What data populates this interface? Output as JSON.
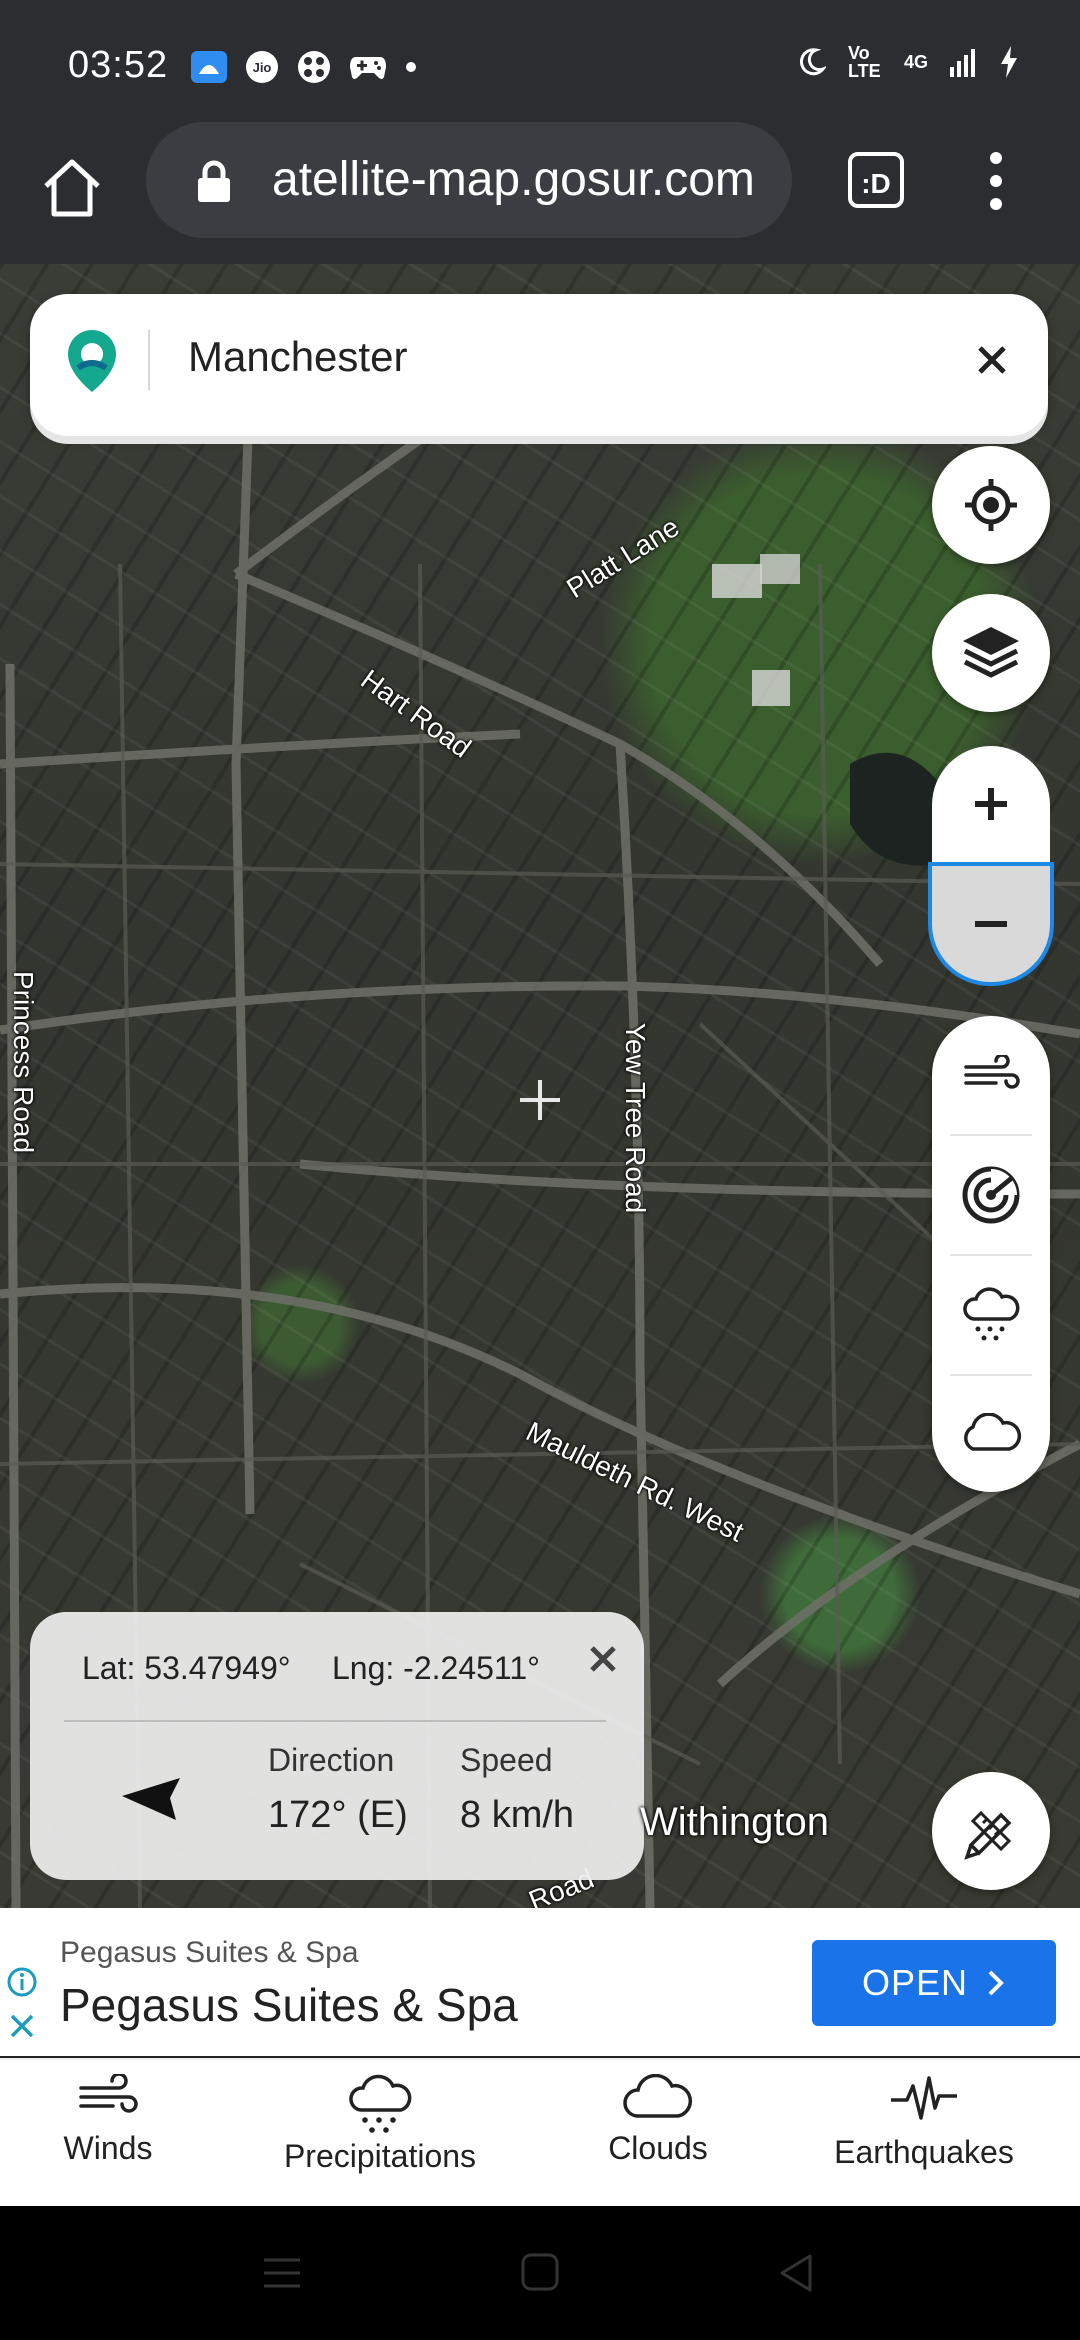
{
  "status_bar": {
    "time": "03:52",
    "network": "4G",
    "volte": "Vo LTE"
  },
  "browser": {
    "url": "atellite-map.gosur.com",
    "tabs_label": ":D"
  },
  "search": {
    "value": "Manchester"
  },
  "map": {
    "road_labels": {
      "platt_lane": "Platt Lane",
      "hart_road": "Hart Road",
      "yew_tree_road": "Yew Tree Road",
      "princess_road": "Princess Road",
      "mauldeth_rd_west": "Mauldeth Rd. West",
      "road_fragment": "Road"
    },
    "place_label": "Withington"
  },
  "info_card": {
    "lat": "Lat: 53.47949°",
    "lng": "Lng: -2.24511°",
    "direction_label": "Direction",
    "direction_value": "172° (E)",
    "speed_label": "Speed",
    "speed_value": "8 km/h"
  },
  "ad": {
    "subtitle": "Pegasus Suites & Spa",
    "title": "Pegasus Suites & Spa",
    "button": "OPEN"
  },
  "bottom_nav": {
    "items": [
      {
        "label": "Winds",
        "icon": "wind-icon"
      },
      {
        "label": "Precipitations",
        "icon": "rain-cloud-icon"
      },
      {
        "label": "Clouds",
        "icon": "cloud-icon"
      },
      {
        "label": "Earthquakes",
        "icon": "seismograph-icon"
      }
    ]
  },
  "colors": {
    "accent": "#1a73e8",
    "status_bar_bg": "#2b2d31",
    "logo_teal": "#14a88f"
  }
}
